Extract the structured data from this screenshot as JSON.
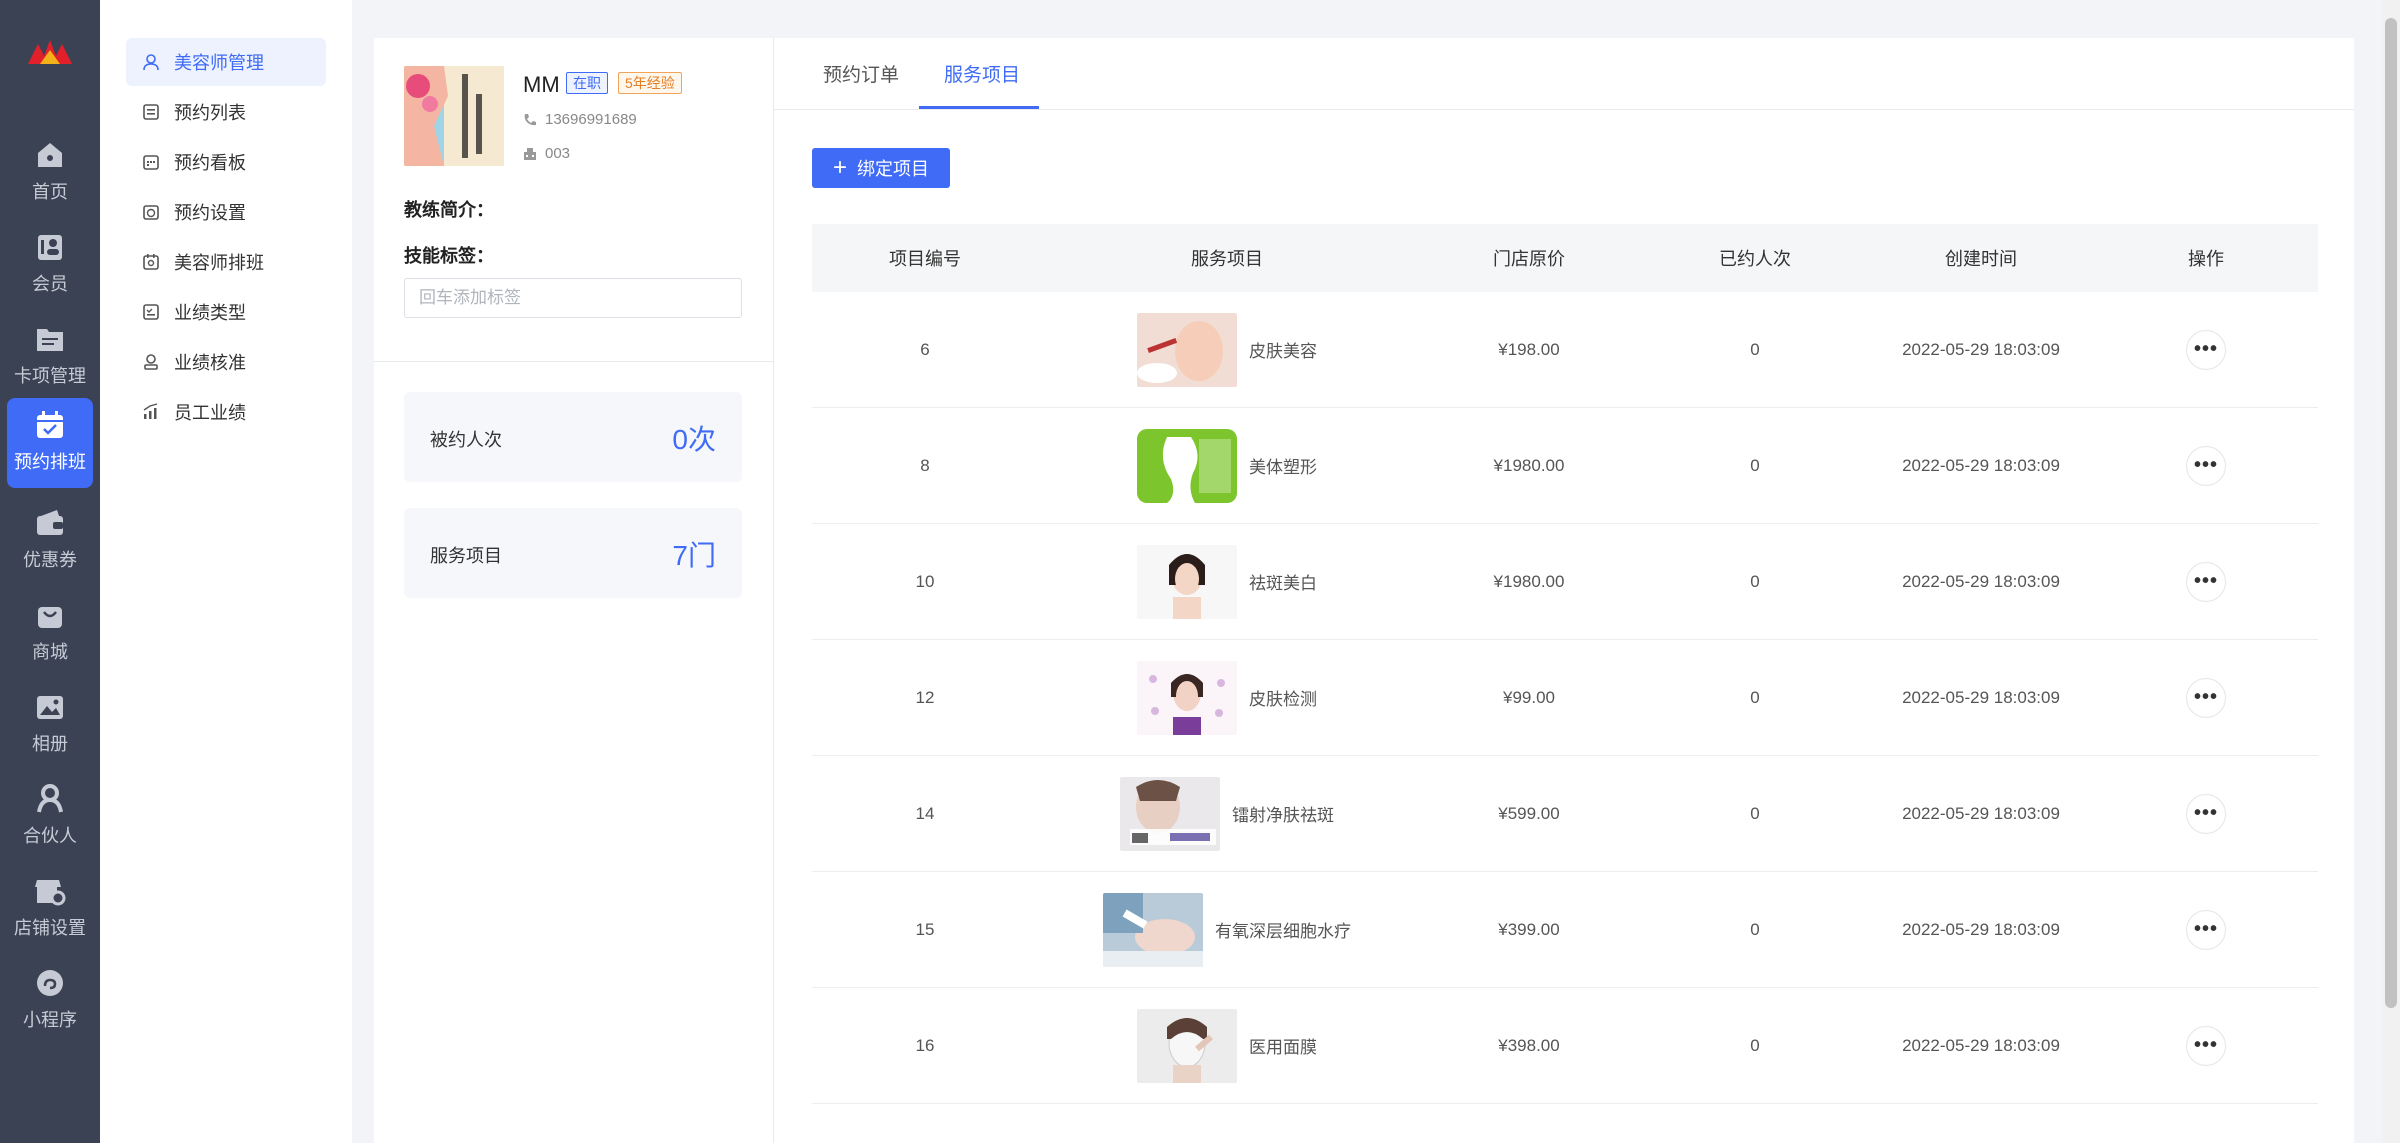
{
  "nav": {
    "items": [
      {
        "label": "首页",
        "icon": "home-icon"
      },
      {
        "label": "会员",
        "icon": "member-icon"
      },
      {
        "label": "卡项管理",
        "icon": "card-icon"
      },
      {
        "label": "预约排班",
        "icon": "calendar-icon"
      },
      {
        "label": "优惠券",
        "icon": "wallet-icon"
      },
      {
        "label": "商城",
        "icon": "shop-bag-icon"
      },
      {
        "label": "相册",
        "icon": "album-icon"
      },
      {
        "label": "合伙人",
        "icon": "partner-icon"
      },
      {
        "label": "店铺设置",
        "icon": "store-settings-icon"
      },
      {
        "label": "小程序",
        "icon": "miniprogram-icon"
      }
    ],
    "active_index": 3,
    "accent": "#3f6bf6"
  },
  "submenu": {
    "items": [
      {
        "label": "美容师管理",
        "icon": "person-icon"
      },
      {
        "label": "预约列表",
        "icon": "list-icon"
      },
      {
        "label": "预约看板",
        "icon": "board-icon"
      },
      {
        "label": "预约设置",
        "icon": "clock-settings-icon"
      },
      {
        "label": "美容师排班",
        "icon": "schedule-icon"
      },
      {
        "label": "业绩类型",
        "icon": "type-icon"
      },
      {
        "label": "业绩核准",
        "icon": "approve-icon"
      },
      {
        "label": "员工业绩",
        "icon": "bar-chart-icon"
      }
    ],
    "active_index": 0
  },
  "profile": {
    "name": "MM",
    "status_tag": "在职",
    "experience_tag": "5年经验",
    "phone": "13696991689",
    "code": "003",
    "intro_label": "教练简介：",
    "skills_label": "技能标签：",
    "tag_placeholder": "回车添加标签",
    "stats": [
      {
        "label": "被约人次",
        "value": "0次"
      },
      {
        "label": "服务项目",
        "value": "7门"
      }
    ]
  },
  "tabs": [
    {
      "label": "预约订单"
    },
    {
      "label": "服务项目"
    }
  ],
  "active_tab": 1,
  "bind_button": "绑定项目",
  "table": {
    "headers": [
      "项目编号",
      "服务项目",
      "门店原价",
      "已约人次",
      "创建时间",
      "操作"
    ],
    "rows": [
      {
        "id": "6",
        "name": "皮肤美容",
        "price": "¥198.00",
        "booked": "0",
        "created": "2022-05-29 18:03:09"
      },
      {
        "id": "8",
        "name": "美体塑形",
        "price": "¥1980.00",
        "booked": "0",
        "created": "2022-05-29 18:03:09"
      },
      {
        "id": "10",
        "name": "祛斑美白",
        "price": "¥1980.00",
        "booked": "0",
        "created": "2022-05-29 18:03:09"
      },
      {
        "id": "12",
        "name": "皮肤检测",
        "price": "¥99.00",
        "booked": "0",
        "created": "2022-05-29 18:03:09"
      },
      {
        "id": "14",
        "name": "镭射净肤祛斑",
        "price": "¥599.00",
        "booked": "0",
        "created": "2022-05-29 18:03:09"
      },
      {
        "id": "15",
        "name": "有氧深层细胞水疗",
        "price": "¥399.00",
        "booked": "0",
        "created": "2022-05-29 18:03:09"
      },
      {
        "id": "16",
        "name": "医用面膜",
        "price": "¥398.00",
        "booked": "0",
        "created": "2022-05-29 18:03:09"
      }
    ]
  },
  "pagination": {
    "current": "1"
  }
}
